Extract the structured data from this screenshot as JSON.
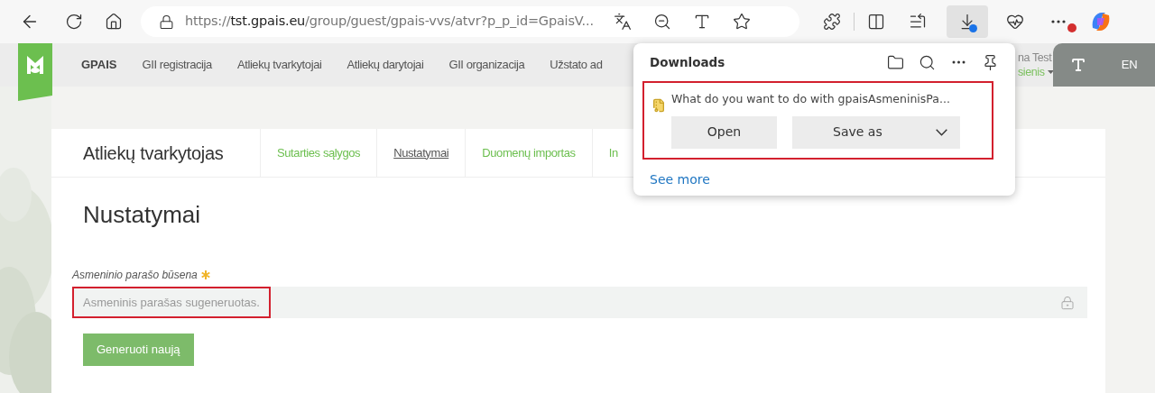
{
  "browser": {
    "url": [
      {
        "text": "https://",
        "emphasis": false
      },
      {
        "text": "tst.gpais.eu",
        "emphasis": true
      },
      {
        "text": "/group/guest/gpais-vvs/atvr?p_p_id=GpaisV...",
        "emphasis": false
      }
    ]
  },
  "site": {
    "brand": "GPAIS",
    "nav": [
      "GII registracija",
      "Atliekų tvarkytojai",
      "Atliekų darytojai",
      "GII organizacija",
      "Užstato ad"
    ],
    "user": {
      "name": "na Test",
      "role": "sienis"
    },
    "language": "EN"
  },
  "card": {
    "title": "Atliekų tvarkytojas",
    "tabs": [
      {
        "label": "Sutarties sąlygos",
        "selected": false
      },
      {
        "label": "Nustatymai",
        "selected": true
      },
      {
        "label": "Duomenų importas",
        "selected": false
      },
      {
        "label": "In",
        "selected": false
      }
    ],
    "heading": "Nustatymai",
    "field": {
      "label": "Asmeninio parašo būsena",
      "required": true,
      "value": "Asmeninis parašas sugeneruotas.",
      "highlighted": true
    },
    "button": "Generuoti naują"
  },
  "downloads": {
    "title": "Downloads",
    "item": {
      "prompt": "What do you want to do with gpaisAsmeninisPa...",
      "highlighted": true
    },
    "buttons": [
      "Open",
      "Save as"
    ],
    "see_more": "See more"
  }
}
